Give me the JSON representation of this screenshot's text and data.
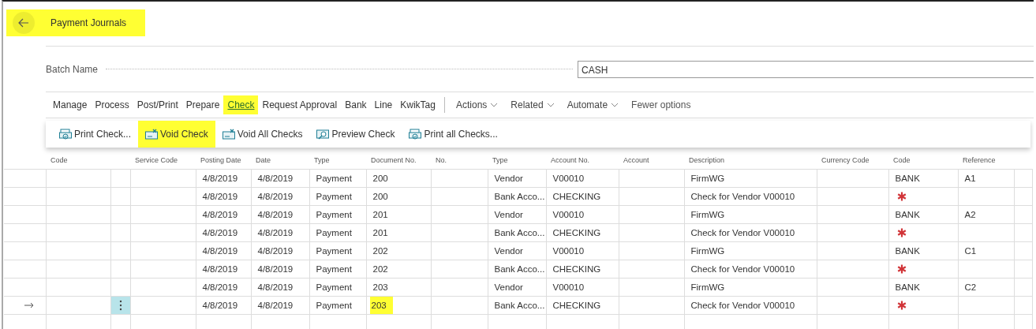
{
  "header": {
    "title": "Payment Journals",
    "highlighted": true
  },
  "batch": {
    "label": "Batch Name",
    "value": "CASH"
  },
  "menu": [
    {
      "label": "Manage",
      "kind": "tab",
      "selected": false
    },
    {
      "label": "Process",
      "kind": "tab",
      "selected": false
    },
    {
      "label": "Post/Print",
      "kind": "tab",
      "selected": false
    },
    {
      "label": "Prepare",
      "kind": "tab",
      "selected": false
    },
    {
      "label": "Check",
      "kind": "tab",
      "selected": true
    },
    {
      "label": "Request Approval",
      "kind": "tab",
      "selected": false
    },
    {
      "label": "Bank",
      "kind": "tab",
      "selected": false
    },
    {
      "label": "Line",
      "kind": "tab",
      "selected": false
    },
    {
      "label": "KwikTag",
      "kind": "tab",
      "selected": false
    },
    {
      "label": "Actions",
      "kind": "dropdown"
    },
    {
      "label": "Related",
      "kind": "dropdown"
    },
    {
      "label": "Automate",
      "kind": "dropdown"
    },
    {
      "label": "Fewer options",
      "kind": "link"
    }
  ],
  "actions": [
    {
      "label": "Print Check...",
      "kind": "print",
      "highlighted": false
    },
    {
      "label": "Void Check",
      "kind": "void",
      "highlighted": true
    },
    {
      "label": "Void All Checks",
      "kind": "void",
      "highlighted": false
    },
    {
      "label": "Preview Check",
      "kind": "preview",
      "highlighted": false
    },
    {
      "label": "Print all Checks...",
      "kind": "print",
      "highlighted": false
    }
  ],
  "table": {
    "columns": [
      {
        "kind": "indicator"
      },
      {
        "label": "Code",
        "kind": "data"
      },
      {
        "kind": "menu"
      },
      {
        "label": "Service Code",
        "kind": "data"
      },
      {
        "label": "Posting Date",
        "kind": "data"
      },
      {
        "label": "Date",
        "kind": "data"
      },
      {
        "label": "Type",
        "kind": "data"
      },
      {
        "label": "Document No.",
        "kind": "data"
      },
      {
        "label": "No.",
        "kind": "data"
      },
      {
        "label": "Type",
        "kind": "data"
      },
      {
        "label": "Account No.",
        "kind": "data"
      },
      {
        "label": "Account",
        "kind": "data"
      },
      {
        "label": "Description",
        "kind": "data"
      },
      {
        "label": "Currency Code",
        "kind": "data"
      },
      {
        "label": "Code",
        "kind": "required"
      },
      {
        "label": "Reference",
        "kind": "data"
      },
      {
        "kind": "filler"
      }
    ],
    "rows": [
      {
        "current": false,
        "posting_date": "4/8/2019",
        "document_date": "4/8/2019",
        "document_type": "Payment",
        "document_no": "200",
        "account_type": "Vendor",
        "account_no": "V00010",
        "description": "FirmWG",
        "payment_method_code": "BANK",
        "payment_reference": "A1",
        "required_missing": false
      },
      {
        "current": false,
        "posting_date": "4/8/2019",
        "document_date": "4/8/2019",
        "document_type": "Payment",
        "document_no": "200",
        "account_type": "Bank Acco...",
        "account_no": "CHECKING",
        "description": "Check for Vendor V00010",
        "required_missing": true
      },
      {
        "current": false,
        "posting_date": "4/8/2019",
        "document_date": "4/8/2019",
        "document_type": "Payment",
        "document_no": "201",
        "account_type": "Vendor",
        "account_no": "V00010",
        "description": "FirmWG",
        "payment_method_code": "BANK",
        "payment_reference": "A2",
        "required_missing": false
      },
      {
        "current": false,
        "posting_date": "4/8/2019",
        "document_date": "4/8/2019",
        "document_type": "Payment",
        "document_no": "201",
        "account_type": "Bank Acco...",
        "account_no": "CHECKING",
        "description": "Check for Vendor V00010",
        "required_missing": true
      },
      {
        "current": false,
        "posting_date": "4/8/2019",
        "document_date": "4/8/2019",
        "document_type": "Payment",
        "document_no": "202",
        "account_type": "Vendor",
        "account_no": "V00010",
        "description": "FirmWG",
        "payment_method_code": "BANK",
        "payment_reference": "C1",
        "required_missing": false
      },
      {
        "current": false,
        "posting_date": "4/8/2019",
        "document_date": "4/8/2019",
        "document_type": "Payment",
        "document_no": "202",
        "account_type": "Bank Acco...",
        "account_no": "CHECKING",
        "description": "Check for Vendor V00010",
        "required_missing": true
      },
      {
        "current": false,
        "posting_date": "4/8/2019",
        "document_date": "4/8/2019",
        "document_type": "Payment",
        "document_no": "203",
        "account_type": "Vendor",
        "account_no": "V00010",
        "description": "FirmWG",
        "payment_method_code": "BANK",
        "payment_reference": "C2",
        "required_missing": false
      },
      {
        "current": true,
        "posting_date": "4/8/2019",
        "document_date": "4/8/2019",
        "document_type": "Payment",
        "document_no": "203",
        "account_type": "Bank Acco...",
        "account_no": "CHECKING",
        "description": "Check for Vendor V00010",
        "required_missing": true,
        "document_no_highlighted": true
      },
      {
        "current": false,
        "required_missing": false
      }
    ]
  }
}
